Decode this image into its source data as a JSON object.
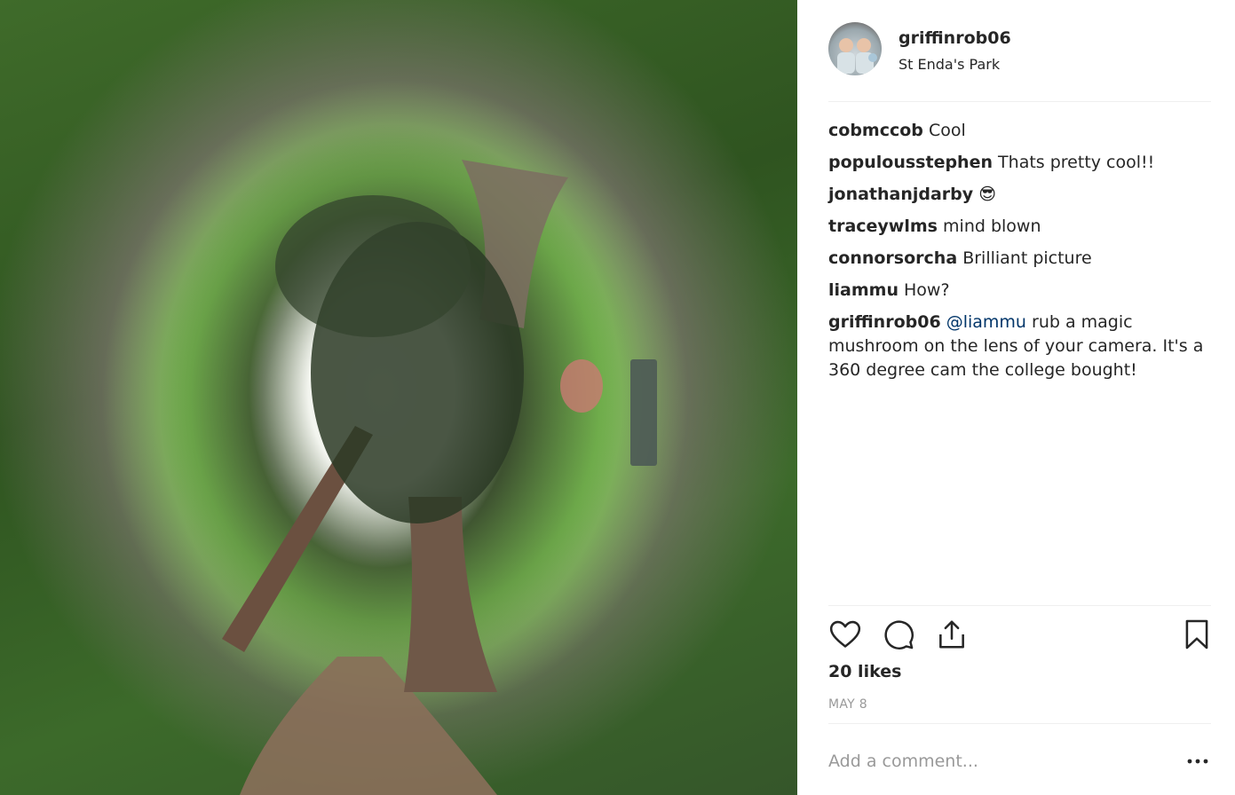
{
  "post": {
    "username": "griffinrob06",
    "location": "St Enda's Park",
    "image_subject": "360 degree tiny-planet park photo"
  },
  "comments": [
    {
      "user": "cobmccob",
      "text": "Cool"
    },
    {
      "user": "populousstephen",
      "text": "Thats pretty cool!!"
    },
    {
      "user": "jonathanjdarby",
      "text": "😎"
    },
    {
      "user": "traceywlms",
      "text": "mind blown"
    },
    {
      "user": "connorsorcha",
      "text": "Brilliant picture"
    },
    {
      "user": "liammu",
      "text": "How?"
    },
    {
      "user": "griffinrob06",
      "mention": "@liammu",
      "text": " rub a magic mushroom on the lens of your camera. It's a 360 degree cam the college bought!"
    }
  ],
  "likes": "20 likes",
  "date": "MAY 8",
  "add_comment_placeholder": "Add a comment...",
  "icons": {
    "like": "heart-icon",
    "comment": "comment-icon",
    "share": "share-icon",
    "save": "bookmark-icon",
    "more": "more-icon"
  },
  "colors": {
    "text": "#262626",
    "muted": "#999999",
    "mention": "#003569",
    "divider": "#efefef"
  }
}
